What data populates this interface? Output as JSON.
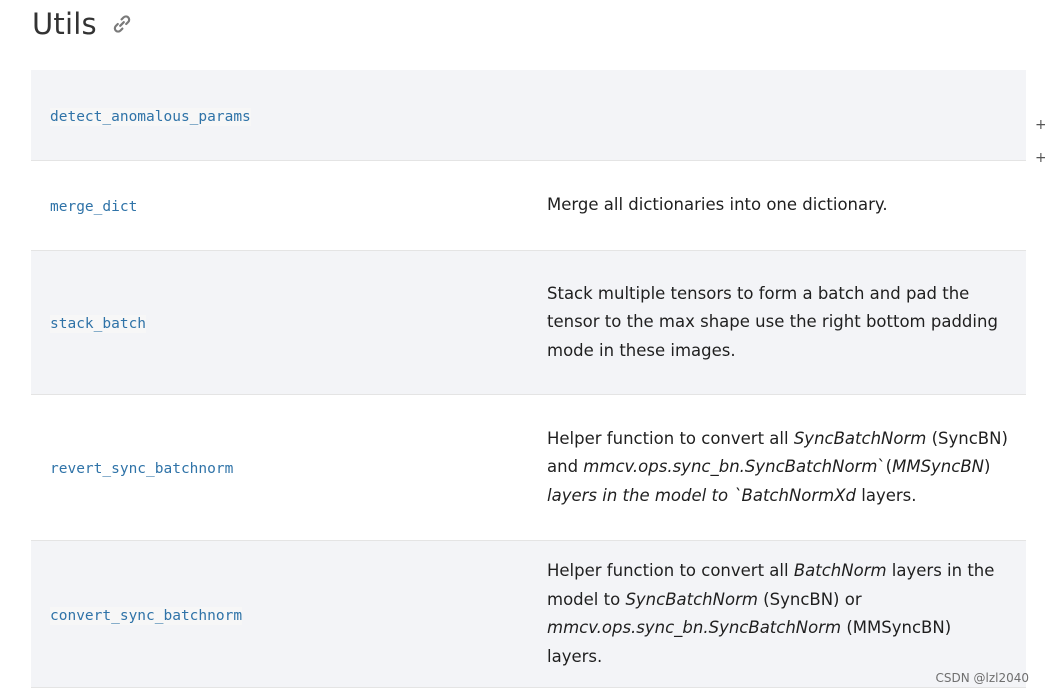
{
  "heading": {
    "title": "Utils",
    "icon": "link-icon"
  },
  "rows": [
    {
      "name": "detect_anomalous_params",
      "desc": []
    },
    {
      "name": "merge_dict",
      "desc": [
        {
          "t": "Merge all dictionaries into one dictionary.",
          "i": false
        }
      ]
    },
    {
      "name": "stack_batch",
      "desc": [
        {
          "t": "Stack multiple tensors to form a batch and pad the tensor to the max shape use the right bottom padding mode in these images.",
          "i": false
        }
      ]
    },
    {
      "name": "revert_sync_batchnorm",
      "desc": [
        {
          "t": "Helper function to convert all ",
          "i": false
        },
        {
          "t": "SyncBatchNorm",
          "i": true
        },
        {
          "t": " (SyncBN) and ",
          "i": false
        },
        {
          "t": "mmcv.ops.sync_bn.SyncBatchNorm",
          "i": true
        },
        {
          "t": "`(",
          "i": false
        },
        {
          "t": "MMSyncBN",
          "i": true
        },
        {
          "t": ") ",
          "i": false
        },
        {
          "t": "layers in the model to `BatchNormXd",
          "i": true
        },
        {
          "t": " layers.",
          "i": false
        }
      ]
    },
    {
      "name": "convert_sync_batchnorm",
      "desc": [
        {
          "t": "Helper function to convert all ",
          "i": false
        },
        {
          "t": "BatchNorm",
          "i": true
        },
        {
          "t": " layers in the model to ",
          "i": false
        },
        {
          "t": "SyncBatchNorm",
          "i": true
        },
        {
          "t": " (SyncBN) or ",
          "i": false
        },
        {
          "t": "mmcv.ops.sync_bn.SyncBatchNorm",
          "i": true
        },
        {
          "t": " (MMSyncBN) layers.",
          "i": false
        }
      ]
    }
  ],
  "expand_controls": [
    "+",
    "+"
  ],
  "watermark": "CSDN @lzl2040"
}
